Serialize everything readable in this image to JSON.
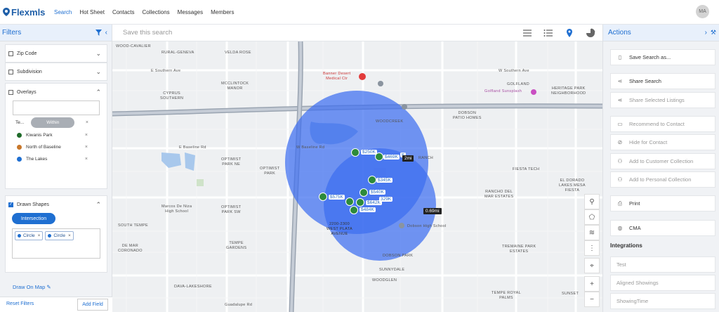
{
  "nav": {
    "logo": "Flexmls",
    "items": [
      "Search",
      "Hot Sheet",
      "Contacts",
      "Collections",
      "Messages",
      "Members"
    ],
    "active": "Search",
    "avatar": "MA"
  },
  "filters": {
    "title": "Filters",
    "zip": "Zip Code",
    "subdivision": "Subdivision",
    "overlays": "Overlays",
    "te": "Te...",
    "within": "Within",
    "overlay_items": [
      {
        "label": "Kiwanis Park",
        "color": "#1f6b2a"
      },
      {
        "label": "North of Baseline",
        "color": "#c8772a"
      },
      {
        "label": "The Lakes",
        "color": "#1f6fd1"
      }
    ],
    "drawn_shapes": "Drawn Shapes",
    "intersection": "Intersection",
    "shapes": [
      "Circle",
      "Circle"
    ],
    "draw_on_map": "Draw On Map",
    "reset": "Reset Filters",
    "add_field": "Add Field"
  },
  "toolbar": {
    "save_placeholder": "Save this search"
  },
  "map": {
    "labels": [
      "WOOD-CAVALIER",
      "RURAL-GENEVA",
      "VELDA ROSE",
      "E Southern Ave",
      "W Southern Ave",
      "Banner Desert\nMedical Ctr",
      "CYPRUS\nSOUTHERN",
      "MCCLINTOCK\nMANOR",
      "GOLFLAND",
      "Golfland Sunsplash",
      "HERITAGE PARK\nNEIGHBORHOOD",
      "WOODCREEK",
      "DOBSON\nPATIO HOMES",
      "W Baseline Rd",
      "E Baseline Rd",
      "OPTIMIST\nPARK NE",
      "OPTIMIST\nPARK",
      "FIESTA TECH",
      "RANCH",
      "RANCHO DEL\nMAR ESTATES",
      "EL DORADO\nLAKES MESA\nFIESTA",
      "Marcos De Niza\nHigh School",
      "OPTIMIST\nPARK SW",
      "2200-2300\nWEST PLATA\nAVENUE",
      "Dobson High School",
      "SOUTH TEMPE",
      "DE MAR\nCORONADO",
      "TEMPE\nGARDENS",
      "DOBSON PARK",
      "TREMAINE PARK\nESTATES",
      "SUNNYDALE",
      "DAVA-LAKESHORE",
      "WOODGLEN",
      "TEMPE ROYAL\nPALMS",
      "SUNSET",
      "Guadalupe Rd"
    ],
    "prices": [
      "$250K",
      "$469K",
      "$345K",
      "$575K",
      "$540K",
      "$642K",
      "$484K",
      "329K",
      "K"
    ],
    "distances": [
      "0.69mi",
      "2mi"
    ]
  },
  "actions": {
    "title": "Actions",
    "items": [
      {
        "label": "Save Search as...",
        "enabled": true
      },
      {
        "label": "Share Search",
        "enabled": true
      },
      {
        "label": "Share Selected Listings",
        "enabled": false
      },
      {
        "label": "Recommend to Contact",
        "enabled": false
      },
      {
        "label": "Hide for Contact",
        "enabled": false
      },
      {
        "label": "Add to Customer Collection",
        "enabled": false
      },
      {
        "label": "Add to Personal Collection",
        "enabled": false
      },
      {
        "label": "Print",
        "enabled": true
      },
      {
        "label": "CMA",
        "enabled": true
      }
    ],
    "integrations_title": "Integrations",
    "integrations": [
      "Test",
      "Aligned Showings",
      "ShowingTime"
    ]
  }
}
